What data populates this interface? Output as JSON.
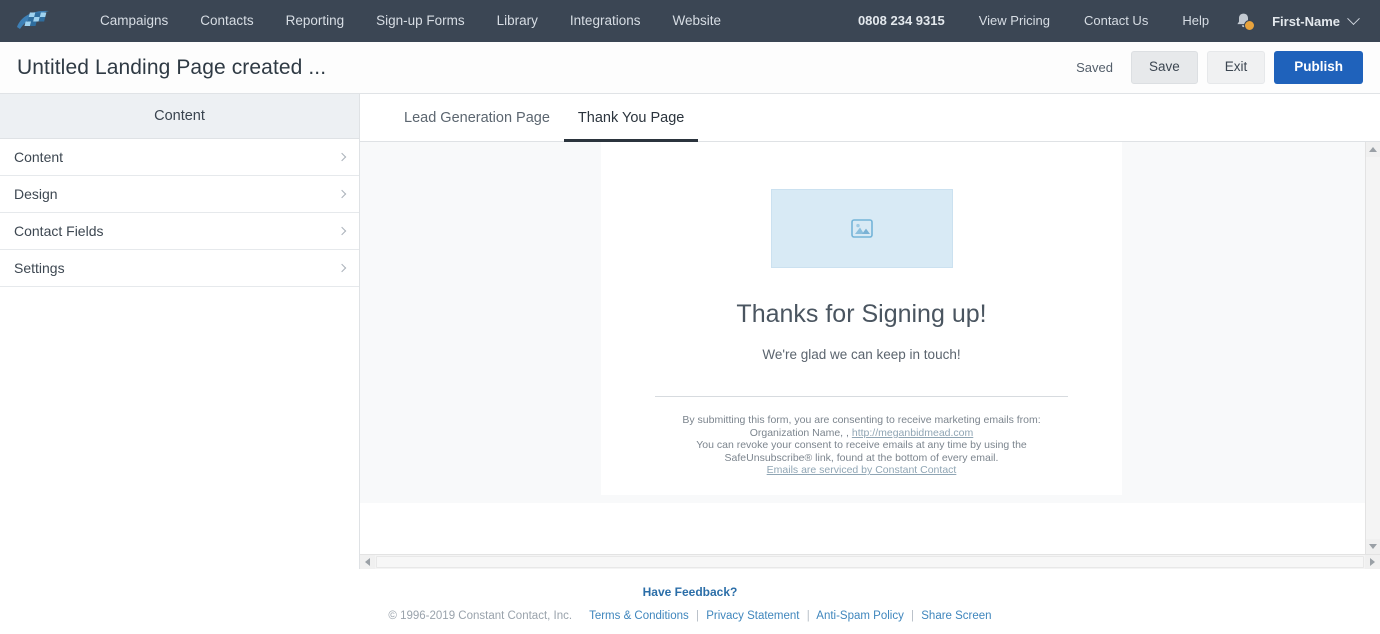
{
  "topnav": {
    "logo_icon": "constant-contact-flag-logo",
    "left_links": [
      {
        "label": "Campaigns"
      },
      {
        "label": "Contacts"
      },
      {
        "label": "Reporting"
      },
      {
        "label": "Sign-up Forms"
      },
      {
        "label": "Library"
      },
      {
        "label": "Integrations"
      },
      {
        "label": "Website"
      }
    ],
    "phone": "0808 234 9315",
    "right_links": [
      {
        "label": "View Pricing"
      },
      {
        "label": "Contact Us"
      },
      {
        "label": "Help"
      }
    ],
    "notification_icon": "bell-icon",
    "notification_badge_color": "#e8a33d",
    "user_name": "First-Name",
    "background_color": "#3b4654"
  },
  "titlebar": {
    "title": "Untitled Landing Page created ...",
    "status": "Saved",
    "save_label": "Save",
    "exit_label": "Exit",
    "publish_label": "Publish",
    "publish_color": "#1f62bb"
  },
  "sidebar": {
    "header": "Content",
    "items": [
      {
        "label": "Content"
      },
      {
        "label": "Design"
      },
      {
        "label": "Contact Fields"
      },
      {
        "label": "Settings"
      }
    ]
  },
  "tabs": [
    {
      "label": "Lead Generation Page",
      "active": false
    },
    {
      "label": "Thank You Page",
      "active": true
    }
  ],
  "landing_page": {
    "image_placeholder_icon": "image-placeholder-icon",
    "heading": "Thanks for Signing up!",
    "subheading": "We're glad we can keep in touch!",
    "disclaimer_line1": "By submitting this form, you are consenting to receive marketing emails from:",
    "disclaimer_line2_prefix": "Organization Name, , ",
    "disclaimer_link": "http://meganbidmead.com",
    "disclaimer_line3": "You can revoke your consent to receive emails at any time by using the",
    "disclaimer_line4": "SafeUnsubscribe® link, found at the bottom of every email.",
    "serviced_link": "Emails are serviced by Constant Contact"
  },
  "scrollbars": {
    "vertical_up_icon": "triangle-up-icon",
    "vertical_down_icon": "triangle-down-icon",
    "horizontal_left_icon": "triangle-left-icon",
    "horizontal_right_icon": "triangle-right-icon"
  },
  "footer": {
    "feedback": "Have Feedback?",
    "copyright": "© 1996-2019 Constant Contact, Inc.",
    "links": [
      {
        "label": "Terms & Conditions"
      },
      {
        "label": "Privacy Statement"
      },
      {
        "label": "Anti-Spam Policy"
      },
      {
        "label": "Share Screen"
      }
    ],
    "separator": "|"
  }
}
